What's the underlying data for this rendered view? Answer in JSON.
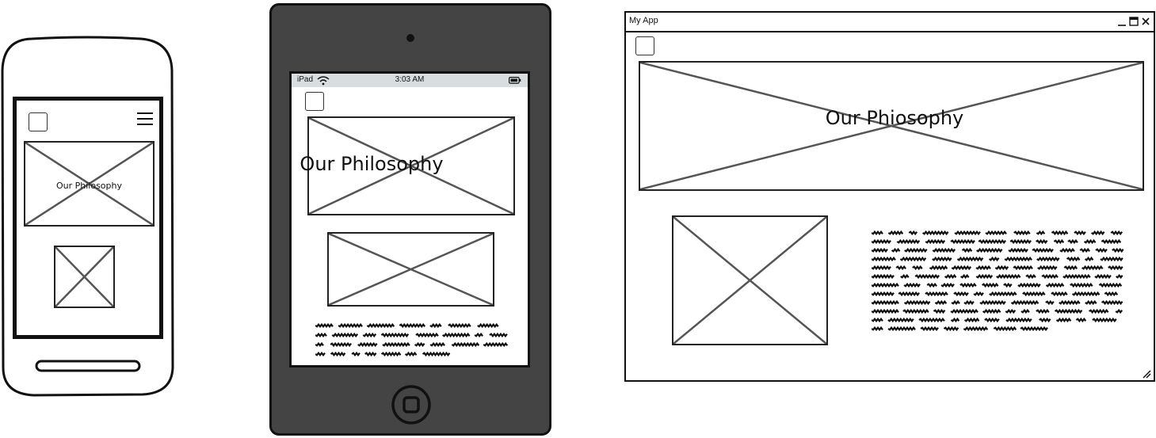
{
  "colors": {
    "line": "#222222",
    "placeholder_cross": "#555555",
    "tablet_body": "#444444",
    "status_bar": "#d8dde0"
  },
  "phone": {
    "hero_title": "Our Philosophy",
    "icons": [
      "logo-placeholder-icon",
      "hamburger-menu-icon"
    ]
  },
  "tablet": {
    "status_bar": {
      "device": "iPad",
      "time": "3:03 AM",
      "icons": [
        "wifi-icon",
        "battery-icon"
      ]
    },
    "hero_title": "Our Philosophy",
    "icons": [
      "camera-icon",
      "logo-placeholder-icon",
      "home-button-icon"
    ]
  },
  "desktop": {
    "window_title": "My App",
    "window_controls": [
      "minimize-icon",
      "maximize-icon",
      "close-icon"
    ],
    "hero_title": "Our Phiosophy",
    "icons": [
      "logo-placeholder-icon",
      "resize-grip-icon"
    ]
  }
}
